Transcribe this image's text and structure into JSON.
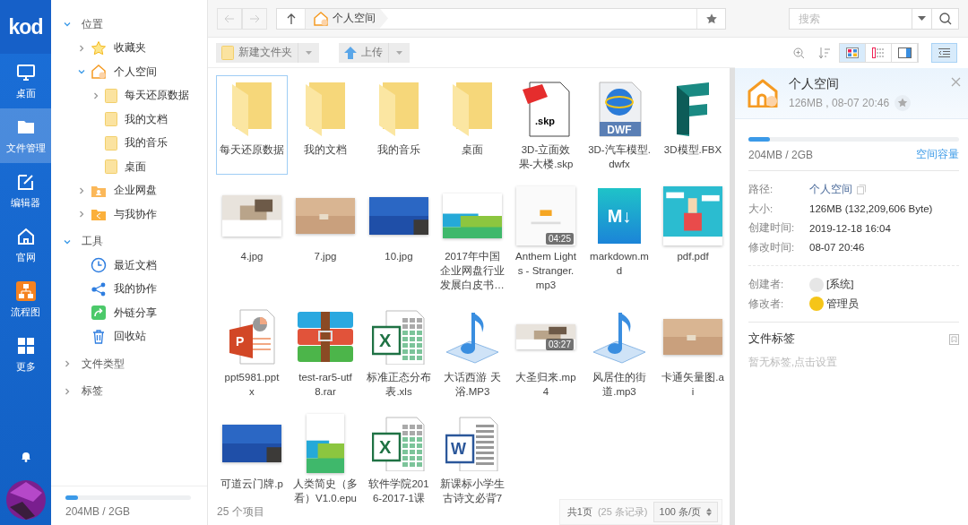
{
  "rail": {
    "logo": "kod",
    "items": [
      {
        "label": "桌面",
        "kind": "monitor",
        "selected": false
      },
      {
        "label": "文件管理",
        "kind": "folder",
        "selected": true
      },
      {
        "label": "编辑器",
        "kind": "edit",
        "selected": false
      },
      {
        "label": "官网",
        "kind": "home",
        "selected": false
      },
      {
        "label": "流程图",
        "kind": "flow",
        "selected": false
      },
      {
        "label": "更多",
        "kind": "grid",
        "selected": false
      }
    ]
  },
  "tree": {
    "sections": [
      {
        "label": "位置",
        "expanded": true,
        "children": [
          {
            "label": "收藏夹",
            "kind": "star",
            "expanded": false
          },
          {
            "label": "个人空间",
            "kind": "home",
            "expanded": true,
            "children": [
              {
                "label": "每天还原数据",
                "kind": "folder",
                "expanded": false
              },
              {
                "label": "我的文档",
                "kind": "folder"
              },
              {
                "label": "我的音乐",
                "kind": "folder"
              },
              {
                "label": "桌面",
                "kind": "folder"
              }
            ]
          },
          {
            "label": "企业网盘",
            "kind": "team",
            "expanded": false
          },
          {
            "label": "与我协作",
            "kind": "share-folder",
            "expanded": false
          }
        ]
      },
      {
        "label": "工具",
        "expanded": true,
        "children": [
          {
            "label": "最近文档",
            "kind": "clock"
          },
          {
            "label": "我的协作",
            "kind": "share"
          },
          {
            "label": "外链分享",
            "kind": "link"
          },
          {
            "label": "回收站",
            "kind": "trash"
          }
        ]
      },
      {
        "label": "文件类型",
        "expanded": false
      },
      {
        "label": "标签",
        "expanded": false
      }
    ],
    "storage": {
      "level": 0.1,
      "text": "204MB / 2GB"
    }
  },
  "address": {
    "breadcrumb": "个人空间",
    "search_placeholder": "搜索"
  },
  "toolbar": {
    "new_folder": "新建文件夹",
    "upload": "上传",
    "views": [
      {
        "kind": "icons",
        "selected": true
      },
      {
        "kind": "list",
        "selected": false
      },
      {
        "kind": "split",
        "selected": false
      }
    ],
    "panel_toggle": {
      "selected": true
    }
  },
  "files": [
    {
      "label": [
        "每天还原数据"
      ],
      "kind": "folder",
      "selected": true
    },
    {
      "label": [
        "我的文档"
      ],
      "kind": "folder",
      "selected": false
    },
    {
      "label": [
        "我的音乐"
      ],
      "kind": "folder",
      "selected": false
    },
    {
      "label": [
        "桌面"
      ],
      "kind": "folder",
      "selected": false
    },
    {
      "label": [
        "3D-立面效",
        "果-大楼.skp"
      ],
      "kind": "skp",
      "glyph": ".skp",
      "selected": false
    },
    {
      "label": [
        "3D-汽车模型.",
        "dwfx"
      ],
      "kind": "dwf",
      "glyph": "DWF",
      "selected": false
    },
    {
      "label": [
        "3D模型.FBX"
      ],
      "kind": "fbx",
      "selected": false
    },
    {
      "label": [
        "4.jpg"
      ],
      "kind": "picture",
      "selected": false
    },
    {
      "label": [
        "7.jpg"
      ],
      "kind": "picture",
      "selected": false
    },
    {
      "label": [
        "10.jpg"
      ],
      "kind": "picture",
      "selected": false
    },
    {
      "label": [
        "2017年中国",
        "企业网盘行业",
        "发展白皮书…"
      ],
      "kind": "picture",
      "selected": false
    },
    {
      "label": [
        "Anthem Light",
        "s - Stranger.",
        "mp3"
      ],
      "kind": "cover",
      "badge": "04:25",
      "selected": false
    },
    {
      "label": [
        "markdown.m",
        "d"
      ],
      "kind": "md",
      "glyph": "M↓",
      "selected": false
    },
    {
      "label": [
        "pdf.pdf"
      ],
      "kind": "picture",
      "selected": false
    },
    {
      "label": [
        "ppt5981.ppt",
        "x"
      ],
      "kind": "ppt",
      "glyph": "P",
      "selected": false
    },
    {
      "label": [
        "test-rar5-utf",
        "8.rar"
      ],
      "kind": "rar",
      "selected": false
    },
    {
      "label": [
        "标准正态分布",
        "表.xls"
      ],
      "kind": "xls",
      "glyph": "X",
      "selected": false
    },
    {
      "label": [
        "大话西游 天",
        "浴.MP3"
      ],
      "kind": "music",
      "selected": false
    },
    {
      "label": [
        "大圣归来.mp",
        "4"
      ],
      "kind": "video",
      "badge": "03:27",
      "selected": false
    },
    {
      "label": [
        "风居住的街",
        "道.mp3"
      ],
      "kind": "music",
      "selected": false
    },
    {
      "label": [
        "卡通矢量图.a",
        "i"
      ],
      "kind": "picture",
      "selected": false
    },
    {
      "label": [
        "可道云门牌.p"
      ],
      "kind": "picture",
      "selected": false
    },
    {
      "label": [
        "人类简史（多",
        "看）V1.0.epu"
      ],
      "kind": "book",
      "selected": false
    },
    {
      "label": [
        "软件学院201",
        "6-2017-1课"
      ],
      "kind": "xls",
      "glyph": "X",
      "selected": false
    },
    {
      "label": [
        "新课标小学生",
        "古诗文必背7"
      ],
      "kind": "doc",
      "glyph": "W",
      "selected": false
    }
  ],
  "status": {
    "count": "25 个项目",
    "pages": "共1页",
    "records": "(25 条记录)",
    "per_page": "100 条/页"
  },
  "details": {
    "title": "个人空间",
    "subtitle": "126MB , 08-07 20:46",
    "storage": {
      "level": 0.1,
      "text": "204MB / 2GB",
      "link": "空间容量"
    },
    "props": [
      {
        "label": "路径:",
        "value": "个人空间",
        "kind": "path"
      },
      {
        "label": "大小:",
        "value": "126MB (132,209,606 Byte)",
        "kind": "text"
      },
      {
        "label": "创建时间:",
        "value": "2019-12-18 16:04",
        "kind": "text"
      },
      {
        "label": "修改时间:",
        "value": "08-07 20:46",
        "kind": "text"
      }
    ],
    "people": [
      {
        "label": "创建者:",
        "value": "[系统]",
        "kind": "system"
      },
      {
        "label": "修改者:",
        "value": "管理员",
        "kind": "admin"
      }
    ],
    "tags_title": "文件标签",
    "tags_hint": "暂无标签,点击设置"
  }
}
